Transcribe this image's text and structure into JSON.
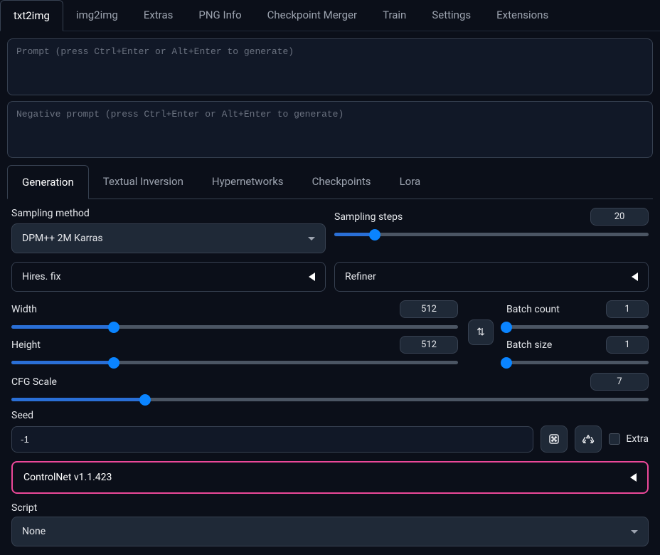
{
  "mainTabs": [
    "txt2img",
    "img2img",
    "Extras",
    "PNG Info",
    "Checkpoint Merger",
    "Train",
    "Settings",
    "Extensions"
  ],
  "activeMainTab": 0,
  "prompt": {
    "placeholder": "Prompt (press Ctrl+Enter or Alt+Enter to generate)"
  },
  "negPrompt": {
    "placeholder": "Negative prompt (press Ctrl+Enter or Alt+Enter to generate)"
  },
  "subTabs": [
    "Generation",
    "Textual Inversion",
    "Hypernetworks",
    "Checkpoints",
    "Lora"
  ],
  "activeSubTab": 0,
  "sampling": {
    "methodLabel": "Sampling method",
    "methodValue": "DPM++ 2M Karras",
    "stepsLabel": "Sampling steps",
    "stepsValue": "20",
    "stepsPercent": 13
  },
  "accordions": {
    "hires": "Hires. fix",
    "refiner": "Refiner"
  },
  "dims": {
    "widthLabel": "Width",
    "widthValue": "512",
    "widthPercent": 23,
    "heightLabel": "Height",
    "heightValue": "512",
    "heightPercent": 23
  },
  "batch": {
    "countLabel": "Batch count",
    "countValue": "1",
    "countPercent": 0,
    "sizeLabel": "Batch size",
    "sizeValue": "1",
    "sizePercent": 0
  },
  "cfg": {
    "label": "CFG Scale",
    "value": "7",
    "percent": 21
  },
  "seed": {
    "label": "Seed",
    "value": "-1",
    "extraLabel": "Extra"
  },
  "controlnet": {
    "label": "ControlNet v1.1.423"
  },
  "script": {
    "label": "Script",
    "value": "None"
  }
}
